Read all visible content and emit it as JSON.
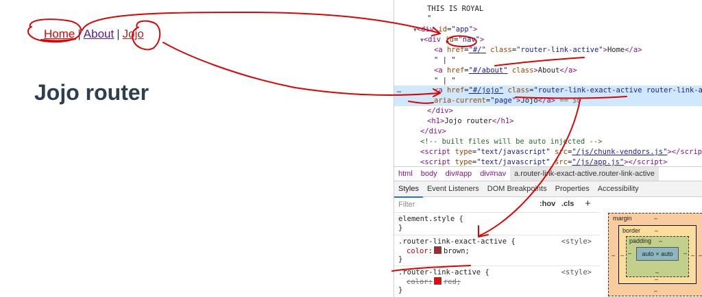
{
  "app": {
    "nav": {
      "home": "Home",
      "about": "About",
      "jojo": "Jojo",
      "separator": "|"
    },
    "heading": "Jojo router"
  },
  "elements": {
    "line0": "THIS IS ROYAL",
    "line1": "\"",
    "div_tag": "div",
    "id_attr": "id",
    "app_id": "\"app\"",
    "nav_id": "\"nav\"",
    "a_tag": "a",
    "href_attr": "href",
    "class_attr": "class",
    "home_href": "\"#/\"",
    "home_class": "\"router-link-active\"",
    "home_text": "Home",
    "sep_text": "\" | \"",
    "about_href": "\"#/about\"",
    "about_text": "About",
    "jojo_href": "\"#/jojo\"",
    "jojo_class": "\"router-link-exact-active router-link-active\"",
    "aria_attr": "aria-current",
    "aria_val": "\"page\"",
    "jojo_text": "Jojo",
    "eq_dollar": "== $0",
    "h1_tag": "h1",
    "h1_text": "Jojo router",
    "comment": "<!-- built files will be auto injected -->",
    "script_tag": "script",
    "type_attr": "type",
    "type_val": "\"text/javascript\"",
    "src_attr": "src",
    "src1": "\"/js/chunk-vendors.js\"",
    "src2": "\"/js/app.js\"",
    "dots": "…"
  },
  "breadcrumbs": [
    "html",
    "body",
    "div#app",
    "div#nav",
    "a.router-link-exact-active.router-link-active"
  ],
  "tabs": [
    "Styles",
    "Event Listeners",
    "DOM Breakpoints",
    "Properties",
    "Accessibility"
  ],
  "styles": {
    "filter_placeholder": "Filter",
    "hov": ":hov",
    "cls": ".cls",
    "plus": "+",
    "element_style": "element.style {",
    "close_brace": "}",
    "rule1_selector": ".router-link-exact-active {",
    "rule1_origin": "<style>",
    "rule1_prop": "color",
    "rule1_value": "brown;",
    "rule1_color": "#a52a2a",
    "rule2_selector": ".router-link-active {",
    "rule2_origin": "<style>",
    "rule2_prop": "color",
    "rule2_value": "red;",
    "rule2_color": "#ff0000",
    "colon": ":"
  },
  "box_model": {
    "margin": "margin",
    "border": "border",
    "padding": "padding",
    "content": "auto × auto",
    "dash": "–"
  },
  "colors": {
    "annotation_red": "#e00000",
    "selection_bg": "#cfe8fc",
    "nav_text": "#2c3e50"
  }
}
